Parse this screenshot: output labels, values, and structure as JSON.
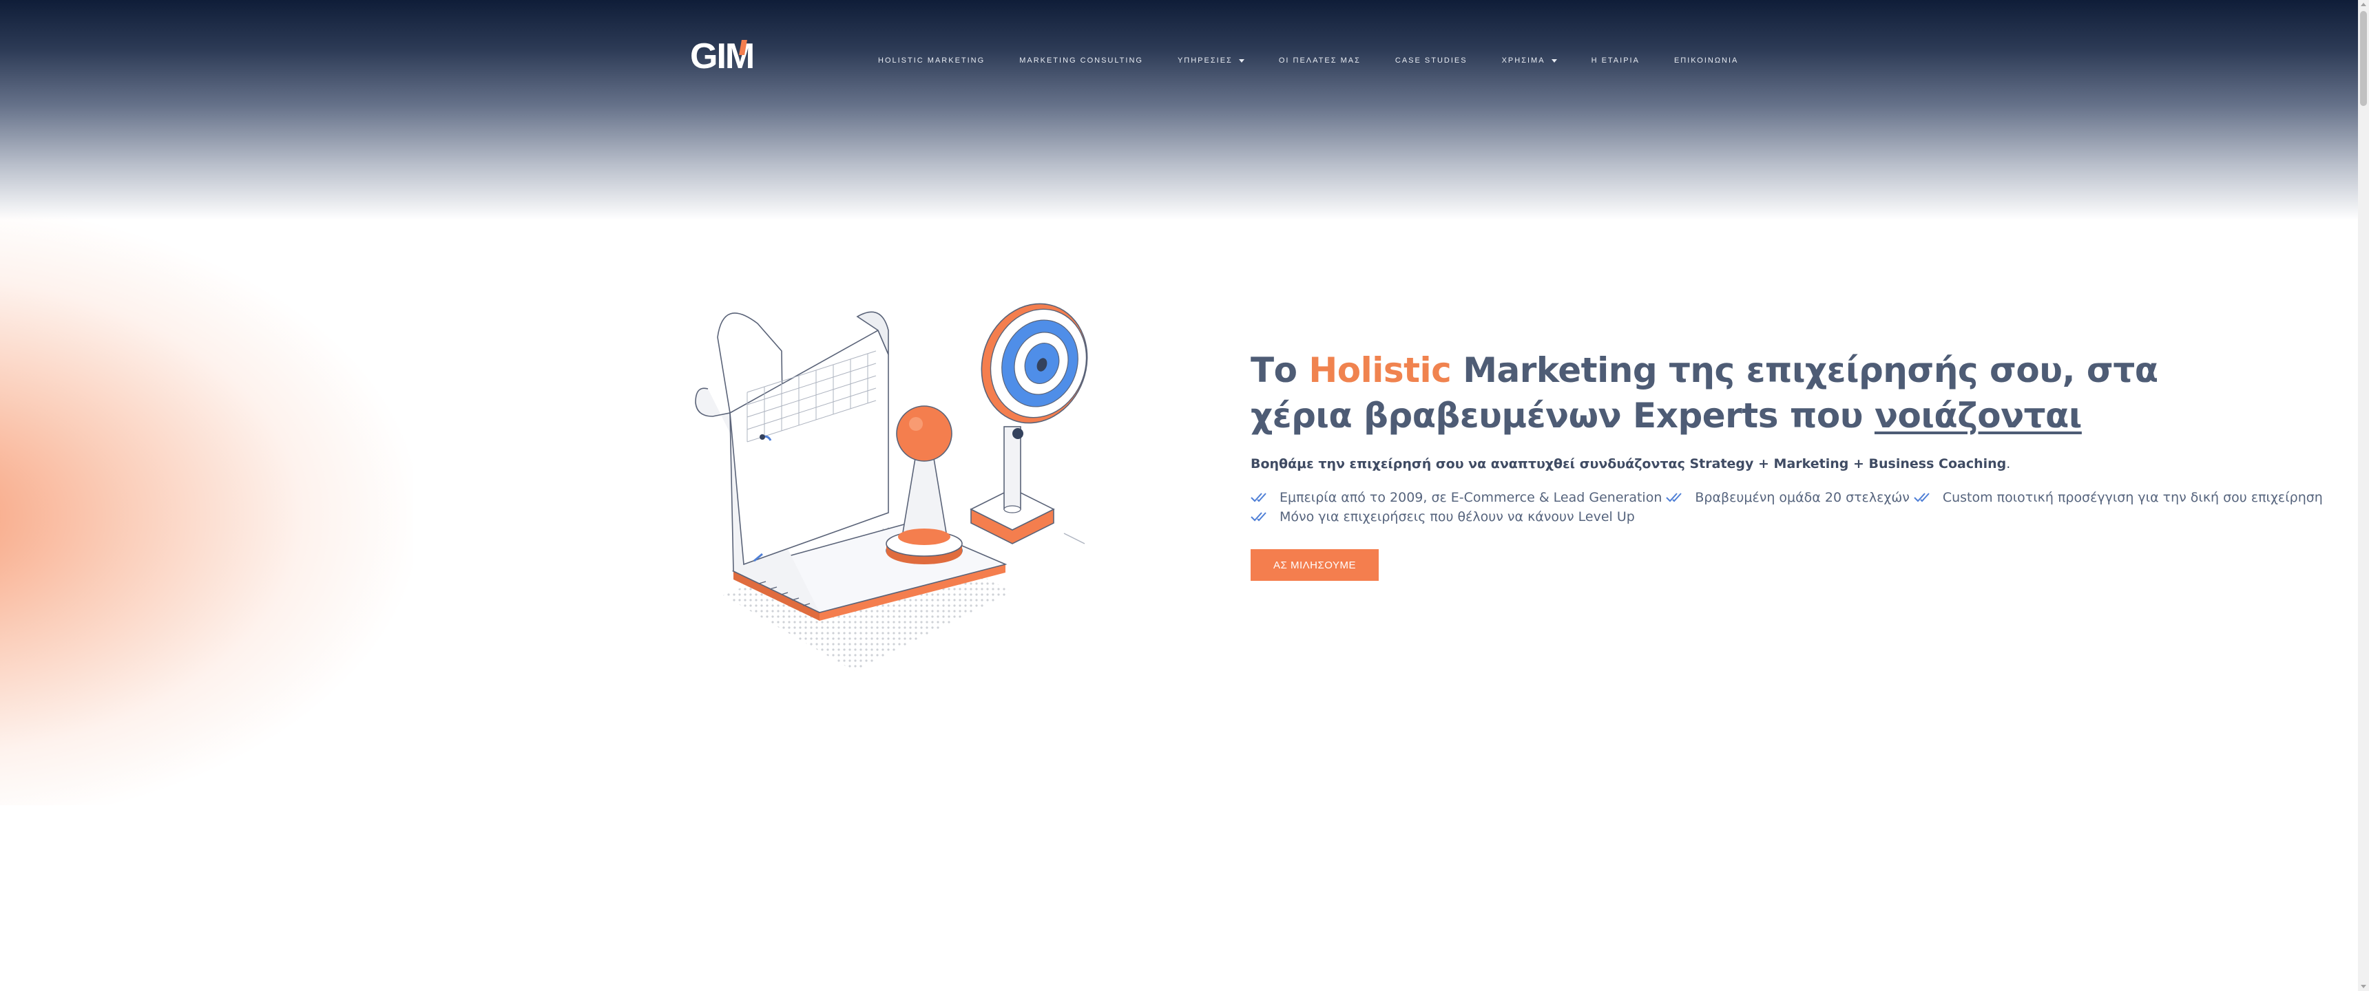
{
  "brand": {
    "logo_text_main": "GI",
    "logo_text_accent": "M",
    "accent_color": "#f47e4e",
    "header_color": "#0f1d38",
    "title_color": "#4e5c75"
  },
  "nav": {
    "items": [
      {
        "label": "HOLISTIC MARKETING",
        "has_dropdown": false
      },
      {
        "label": "MARKETING CONSULTING",
        "has_dropdown": false
      },
      {
        "label": "ΥΠΗΡΕΣΙΕΣ",
        "has_dropdown": true
      },
      {
        "label": "ΟΙ ΠΕΛΑΤΕΣ ΜΑΣ",
        "has_dropdown": false
      },
      {
        "label": "CASE STUDIES",
        "has_dropdown": false
      },
      {
        "label": "ΧΡΗΣΙΜΑ",
        "has_dropdown": true
      },
      {
        "label": "Η ΕΤΑΙΡΙΑ",
        "has_dropdown": false
      },
      {
        "label": "ΕΠΙΚΟΙΝΩΝΙΑ",
        "has_dropdown": false
      }
    ]
  },
  "hero": {
    "title_part1": "Το ",
    "title_highlight": "Holistic",
    "title_part2": " Marketing της επιχείρησής σου, στα χέρια βραβευμένων Experts που ",
    "title_underlined": "νοιάζονται",
    "subtitle_bold": "Βοηθάμε την επιχείρησή σου να αναπτυχθεί συνδυάζοντας Strategy + Marketing + Business Coaching",
    "subtitle_end": ".",
    "bullets": [
      "Εμπειρία από το 2009, σε E-Commerce & Lead Generation",
      "Βραβευμένη ομάδα 20 στελεχών",
      "Custom ποιοτική προσέγγιση για την δική σου επιχείρηση",
      "Μόνο για επιχειρήσεις που θέλουν να κάνουν Level Up"
    ],
    "cta_label": "ΑΣ ΜΙΛΗΣΟΥΜΕ"
  },
  "illustration": {
    "icon_name": "strategy-board-target-illustration"
  }
}
